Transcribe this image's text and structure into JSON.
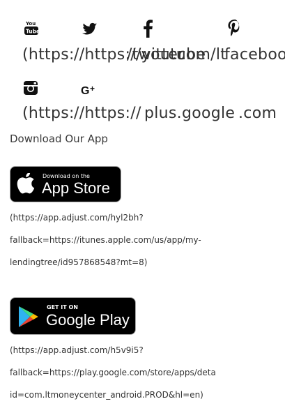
{
  "social": {
    "row1": {
      "icons": [
        "youtube-icon",
        "twitter-icon",
        "facebook-icon",
        "pinterest-icon"
      ],
      "link_text": "(https://https://twitter.com/ltfacebook",
      "overlap": [
        "(https:",
        "//https://youtube",
        "/twitter",
        ".com/lt",
        "facebook"
      ]
    },
    "row2": {
      "icons": [
        "instagram-icon",
        "google-plus-icon"
      ],
      "overlap": [
        "(https:",
        "//https://",
        "plus.google",
        ".com"
      ]
    }
  },
  "app_section": {
    "heading": "Download Our App",
    "app_store": {
      "small_label": "Download on the",
      "big_label": "App Store",
      "link_lines": [
        "(https://app.adjust.com/hyl2bh?",
        "fallback=https://itunes.apple.com/us/app/my-",
        "lendingtree/id957868548?mt=8)"
      ]
    },
    "google_play": {
      "small_label": "GET IT ON",
      "big_label": "Google Play",
      "link_lines": [
        "(https://app.adjust.com/h5v9i5?",
        "fallback=https://play.google.com/store/apps/deta",
        "id=com.ltmoneycenter_android.PROD&hl=en)"
      ]
    }
  }
}
